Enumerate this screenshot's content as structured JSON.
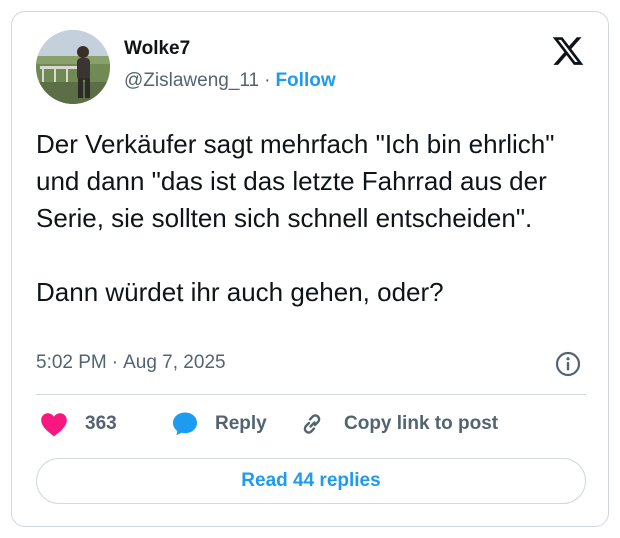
{
  "author": {
    "display_name": "Wolke7",
    "handle": "@Zislaweng_11",
    "separator": "·",
    "follow_label": "Follow"
  },
  "post": {
    "paragraphs": [
      "Der Verkäufer sagt mehrfach \"Ich bin ehrlich\" und dann \"das ist das letzte Fahrrad aus der Serie, sie sollten sich schnell entscheiden\".",
      "Dann würdet ihr auch gehen, oder?"
    ],
    "time": "5:02 PM",
    "separator": "·",
    "date": "Aug 7, 2025"
  },
  "actions": {
    "like_count": "363",
    "reply_label": "Reply",
    "copy_link_label": "Copy link to post"
  },
  "read_replies_label": "Read 44 replies",
  "colors": {
    "accent": "#1d9bf0",
    "like": "#f91880",
    "muted_text": "#536471",
    "text": "#0f1419"
  },
  "icons": {
    "brand": "x-logo-icon",
    "info": "info-icon",
    "like": "heart-icon",
    "reply": "speech-bubble-icon",
    "copy": "link-icon"
  }
}
